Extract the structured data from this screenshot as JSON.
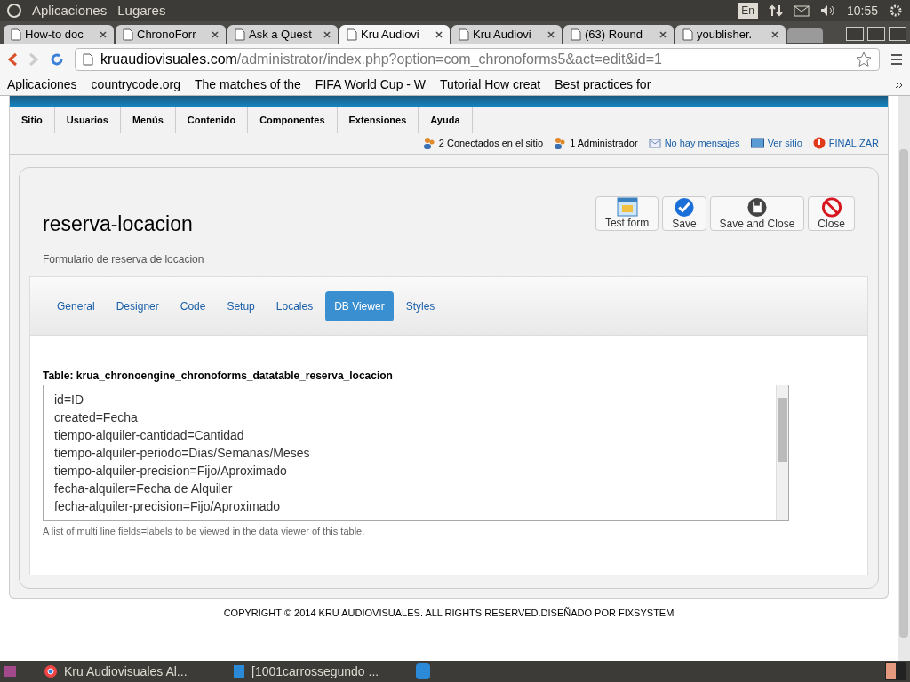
{
  "top_bar": {
    "menus": [
      "Aplicaciones",
      "Lugares"
    ],
    "keyboard": "En",
    "clock": "10:55"
  },
  "browser_tabs": [
    {
      "title": "How-to doc",
      "selected": false
    },
    {
      "title": "ChronoForr",
      "selected": false
    },
    {
      "title": "Ask a Quest",
      "selected": false
    },
    {
      "title": "Kru Audiovi",
      "selected": true
    },
    {
      "title": "Kru Audiovi",
      "selected": false
    },
    {
      "title": "(63) Round",
      "selected": false
    },
    {
      "title": "youblisher.",
      "selected": false
    }
  ],
  "address": {
    "host": "kruaudiovisuales.com",
    "path": "/administrator/index.php?option=com_chronoforms5&act=edit&id=1"
  },
  "bookmarks": [
    "Aplicaciones",
    "countrycode.org",
    "The matches of the",
    "FIFA World Cup - W",
    "Tutorial How creat",
    "Best practices for"
  ],
  "admin_menu": [
    "Sitio",
    "Usuarios",
    "Menús",
    "Contenido",
    "Componentes",
    "Extensiones",
    "Ayuda"
  ],
  "status_links": [
    {
      "text": "2 Conectados en el sitio",
      "kind": "users"
    },
    {
      "text": "1 Administrador",
      "kind": "users"
    },
    {
      "text": "No hay mensajes",
      "kind": "mail"
    },
    {
      "text": "Ver sitio",
      "kind": "screen"
    },
    {
      "text": "FINALIZAR",
      "kind": "logout"
    }
  ],
  "form": {
    "title": "reserva-locacion",
    "description": "Formulario de reserva de locacion",
    "toolbar": [
      {
        "label": "Test form",
        "kind": "test"
      },
      {
        "label": "Save",
        "kind": "save"
      },
      {
        "label": "Save and Close",
        "kind": "disk"
      },
      {
        "label": "Close",
        "kind": "close"
      }
    ],
    "tabs": [
      {
        "label": "General",
        "selected": false
      },
      {
        "label": "Designer",
        "selected": false
      },
      {
        "label": "Code",
        "selected": false
      },
      {
        "label": "Setup",
        "selected": false
      },
      {
        "label": "Locales",
        "selected": false
      },
      {
        "label": "DB Viewer",
        "selected": true
      },
      {
        "label": "Styles",
        "selected": false
      }
    ],
    "field_label": "Table: krua_chronoengine_chronoforms_datatable_reserva_locacion",
    "field_lines": [
      "id=ID",
      "created=Fecha",
      "tiempo-alquiler-cantidad=Cantidad",
      "tiempo-alquiler-periodo=Dias/Semanas/Meses",
      "tiempo-alquiler-precision=Fijo/Aproximado",
      "fecha-alquiler=Fecha de Alquiler",
      "fecha-alquiler-precision=Fijo/Aproximado"
    ],
    "field_help": "A list of multi line fields=labels to be viewed in the data viewer of this table."
  },
  "footer": "COPYRIGHT © 2014 KRU AUDIOVISUALES. ALL RIGHTS RESERVED.DISEÑADO POR FIXSYSTEM",
  "taskbar": [
    {
      "title": "Kru Audiovisuales Al...",
      "kind": "chrome"
    },
    {
      "title": "[1001carrossegundo ...",
      "kind": "ide"
    }
  ]
}
